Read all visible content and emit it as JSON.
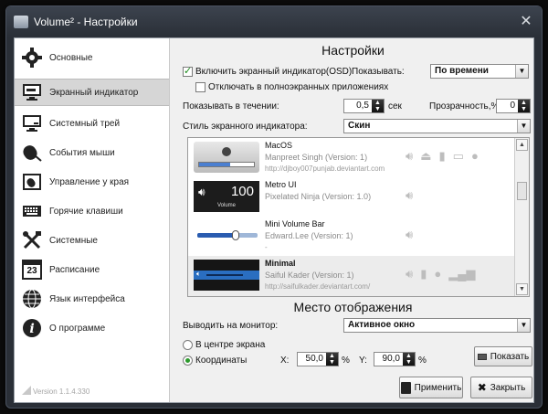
{
  "window": {
    "title": "Volume² - Настройки"
  },
  "sidebar": {
    "items": [
      {
        "label": "Основные",
        "icon": "gear-icon"
      },
      {
        "label": "Экранный индикатор",
        "icon": "monitor-icon"
      },
      {
        "label": "Системный трей",
        "icon": "tray-icon"
      },
      {
        "label": "События мыши",
        "icon": "mouse-icon"
      },
      {
        "label": "Управление у края",
        "icon": "screen-edge-icon"
      },
      {
        "label": "Горячие клавиши",
        "icon": "keyboard-icon"
      },
      {
        "label": "Системные",
        "icon": "tools-icon"
      },
      {
        "label": "Расписание",
        "icon": "calendar-icon"
      },
      {
        "label": "Язык интерфейса",
        "icon": "globe-icon"
      },
      {
        "label": "О программе",
        "icon": "info-icon"
      }
    ],
    "calendar_day": "23",
    "version": "Version 1.1.4.330"
  },
  "settings": {
    "title": "Настройки",
    "enable_osd_label": "Включить экранный индикатор(OSD)",
    "show_label": "Показывать:",
    "show_value": "По времени",
    "disable_fullscreen_label": "Отключать в полноэкранных приложениях",
    "show_during_label": "Показывать в течении:",
    "show_during_value": "0,5",
    "show_during_unit": "сек",
    "transparency_label": "Прозрачность,%:",
    "transparency_value": "0",
    "style_label": "Стиль экранного индикатора:",
    "style_value": "Скин"
  },
  "skins": [
    {
      "name": "MacOS",
      "author": "Manpreet Singh (Version: 1)",
      "url": "http://djboy007punjab.deviantart.com"
    },
    {
      "name": "Metro UI",
      "author": "Pixelated Ninja (Version: 1.0)",
      "url": "",
      "preview_value": "100",
      "preview_caption": "Volume"
    },
    {
      "name": "Mini Volume Bar",
      "author": "Edward.Lee (Version: 1)",
      "url": "-"
    },
    {
      "name": "Minimal",
      "author": "Saiful Kader (Version: 1)",
      "url": "http://saifulkader.deviantart.com/"
    }
  ],
  "location": {
    "title": "Место отображения",
    "monitor_label": "Выводить на монитор:",
    "monitor_value": "Активное окно",
    "center_label": "В центре экрана",
    "coords_label": "Координаты",
    "x_label": "X:",
    "x_value": "50,0",
    "y_label": "Y:",
    "y_value": "90,0",
    "percent": "%",
    "show_button": "Показать"
  },
  "footer": {
    "apply_button": "Применить",
    "close_button": "Закрыть"
  },
  "colors": {
    "accent": "#2d9a2d",
    "titlebar": "#2a2f37"
  }
}
